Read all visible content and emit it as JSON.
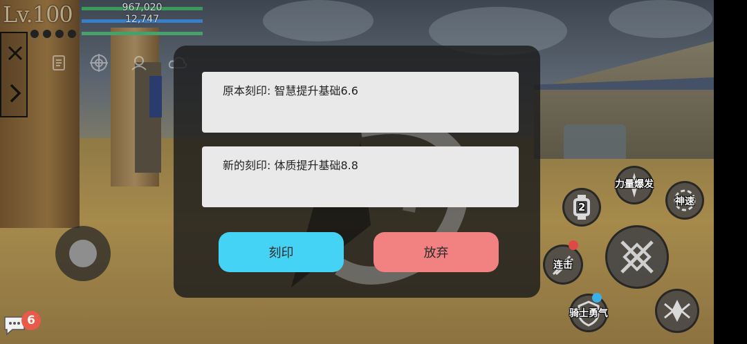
{
  "hud": {
    "level": "Lv.100",
    "hp_value": "967,020",
    "mp_value": "12,747"
  },
  "dialog": {
    "original_label": "原本刻印:",
    "original_value": "智慧提升基础6.6",
    "new_label": "新的刻印:",
    "new_value": "体质提升基础8.8",
    "engrave_button": "刻印",
    "abandon_button": "放弃"
  },
  "skills": {
    "power_burst": "力量爆发",
    "divine_speed": "神速",
    "slot_number": "2",
    "combo": "连击",
    "knight_courage": "骑士勇气"
  },
  "chat": {
    "unread_count": "6"
  },
  "colors": {
    "engrave": "#45d3f5",
    "abandon": "#f28181",
    "badge": "#e85a4a"
  }
}
